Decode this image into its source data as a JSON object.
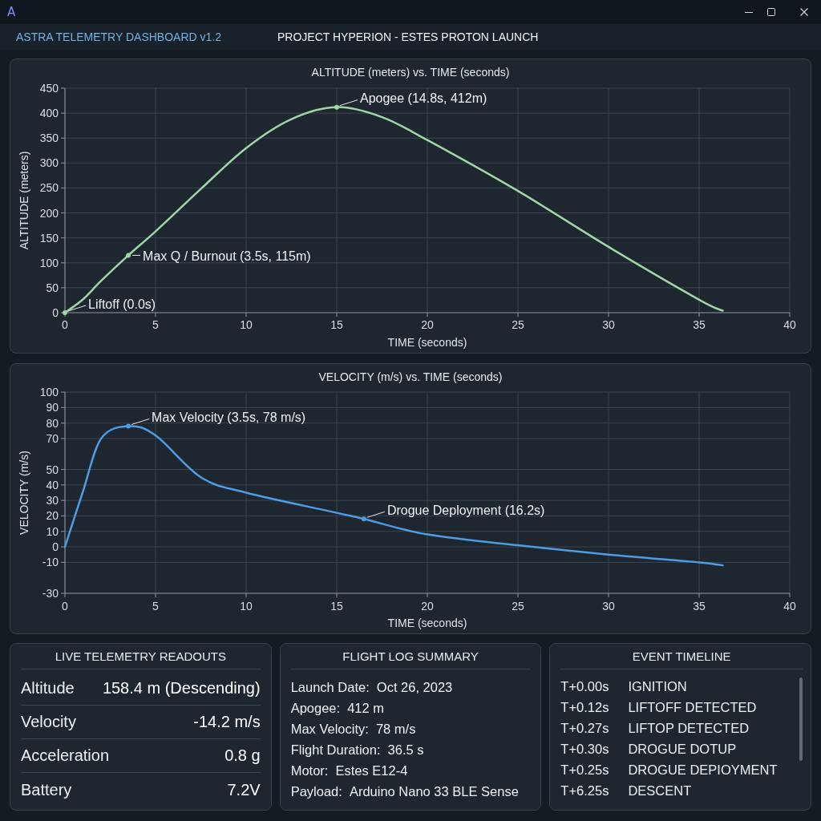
{
  "window": {
    "logo": "A"
  },
  "header": {
    "app_name": "ASTRA TELEMETRY DASHBOARD v1.2",
    "mission": "PROJECT HYPERION - ESTES PROTON LAUNCH"
  },
  "altitude_panel": {
    "chart_data": {
      "type": "line",
      "title": "ALTITUDE (meters) vs. TIME (seconds)",
      "xlabel": "TIME (seconds)",
      "ylabel": "ALTITUDE (meters)",
      "x": [
        0,
        1,
        2,
        3.5,
        5,
        7.5,
        10,
        12.5,
        15,
        17.5,
        20,
        25,
        30,
        35,
        36.3
      ],
      "values": [
        0,
        27,
        64,
        115,
        163,
        248,
        330,
        388,
        412,
        392,
        346,
        244,
        132,
        26,
        4
      ],
      "xlim": [
        0,
        40
      ],
      "ylim": [
        0,
        450
      ],
      "xticks": [
        0,
        5,
        10,
        15,
        20,
        25,
        30,
        35,
        40
      ],
      "yticks": [
        0,
        50,
        100,
        150,
        200,
        250,
        300,
        350,
        400,
        450
      ],
      "grid": true,
      "annotations": [
        {
          "text": "Liftoff (0.0s)",
          "x": 0,
          "y": 0
        },
        {
          "text": "Max Q / Burnout (3.5s, 115m)",
          "x": 3.5,
          "y": 115
        },
        {
          "text": "Apogee (14.8s, 412m)",
          "x": 15,
          "y": 412
        }
      ]
    }
  },
  "velocity_panel": {
    "chart_data": {
      "type": "line",
      "title": "VELOCITY (m/s) vs. TIME (seconds)",
      "xlabel": "TIME (seconds)",
      "ylabel": "VELOCITY (m/s)",
      "x": [
        0,
        1,
        2,
        3.5,
        5,
        7.5,
        10,
        15,
        16.5,
        20,
        25,
        30,
        35,
        36.3
      ],
      "values": [
        0,
        36,
        70,
        78,
        72,
        45,
        35,
        22,
        18,
        8,
        1,
        -5,
        -10,
        -12
      ],
      "xlim": [
        0,
        40
      ],
      "ylim": [
        -30,
        100
      ],
      "xticks": [
        0,
        5,
        10,
        15,
        20,
        25,
        30,
        35,
        40
      ],
      "yticks": [
        100,
        90,
        80,
        70,
        50,
        40,
        30,
        20,
        10,
        0,
        -10,
        -30
      ],
      "grid": true,
      "annotations": [
        {
          "text": "Max Velocity (3.5s, 78 m/s)",
          "x": 3.5,
          "y": 78
        },
        {
          "text": "Drogue Deployment (16.2s)",
          "x": 16.5,
          "y": 18
        }
      ]
    }
  },
  "live_readouts": {
    "title": "LIVE TELEMETRY READOUTS",
    "rows": [
      {
        "label": "Altitude",
        "value": "158.4 m (Descending)"
      },
      {
        "label": "Velocity",
        "value": "-14.2 m/s"
      },
      {
        "label": "Acceleration",
        "value": "0.8 g"
      },
      {
        "label": "Battery",
        "value": "7.2V"
      }
    ]
  },
  "flight_log": {
    "title": "FLIGHT LOG SUMMARY",
    "rows": [
      {
        "label": "Launch Date:",
        "value": "Oct 26, 2023"
      },
      {
        "label": "Apogee:",
        "value": "412 m"
      },
      {
        "label": "Max Velocity:",
        "value": "78 m/s"
      },
      {
        "label": "Flight Duration:",
        "value": "36.5 s"
      },
      {
        "label": "Motor:",
        "value": "Estes E12-4"
      },
      {
        "label": "Payload:",
        "value": "Arduino Nano 33 BLE Sense"
      }
    ]
  },
  "event_timeline": {
    "title": "EVENT TIMELINE",
    "events": [
      {
        "time": "T+0.00s",
        "event": "IGNITION"
      },
      {
        "time": "T+0.12s",
        "event": "LIFTOFF DETECTED"
      },
      {
        "time": "T+0.27s",
        "event": "LIFTOP DETECTED"
      },
      {
        "time": "T+0.30s",
        "event": "DROGUE DOTUP"
      },
      {
        "time": "T+0.25s",
        "event": "DROGUE DEPIOYMENT"
      },
      {
        "time": "T+6.25s",
        "event": "DESCENT"
      }
    ]
  }
}
